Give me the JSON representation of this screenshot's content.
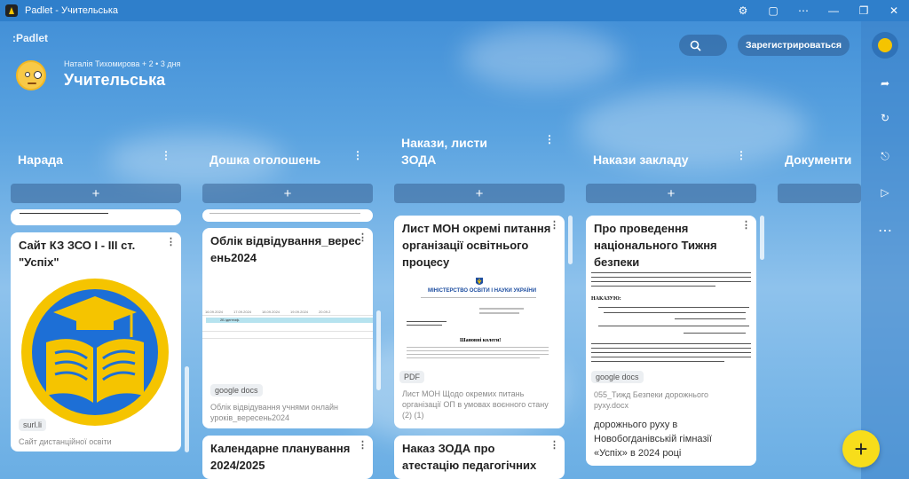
{
  "window": {
    "title": "Padlet - Учительська",
    "controls": [
      "Предпочтения",
      "Приложение",
      "Еще",
      "Свернуть",
      "Восстановить",
      "Закрыть"
    ]
  },
  "header": {
    "logo": ":Padlet",
    "meta": "Наталія Тихомирова + 2 • 3 дня",
    "title": "Учительська",
    "register_label": "Зарегистрироваться",
    "search_icon": "search-icon"
  },
  "rail": {
    "items": [
      "ideas-icon",
      "share-icon",
      "remake-icon",
      "bell-icon",
      "play-icon",
      "more-icon"
    ]
  },
  "fab_label": "+",
  "add_label": "+",
  "columns": [
    {
      "title": "Нарада",
      "cards": [
        {
          "title": "Сайт КЗ ЗСО І - ІІІ ст. \"Успіх\"",
          "tag": "surl.li",
          "subtitle": "Сайт дистанційної освіти",
          "colors": {
            "outer": "#f5c400",
            "inner": "#1d6fd6"
          }
        }
      ]
    },
    {
      "title": "Дошка оголошень",
      "cards": [
        {
          "title": "Облік відвідування_вересень2024",
          "tag": "google docs",
          "subtitle": "Облік відвідування учнями онлайн уроків_вересень2024",
          "sheet_dates": [
            "16.09.2024",
            "17.09.2024",
            "18.09.2024",
            "19.09.2024",
            "20.09.2"
          ],
          "sheet_label": "2Б ідентиф."
        },
        {
          "title": "Календарне планування 2024/2025"
        }
      ]
    },
    {
      "title": "Накази, листи ЗОДА",
      "cards": [
        {
          "title": "Лист МОН окремі питання організації освітнього процесу",
          "tag": "PDF",
          "subtitle": "Лист МОН Щодо окремих питань організації ОП в умовах воєнного стану (2) (1)",
          "doc_header": "МІНІСТЕРСТВО ОСВІТИ І НАУКИ УКРАЇНИ",
          "doc_greeting": "Шановні колеги!"
        },
        {
          "title": "Наказ ЗОДА про атестацію педагогічних"
        }
      ]
    },
    {
      "title": "Накази закладу",
      "cards": [
        {
          "title": "Про проведення національного Тижня безпеки",
          "tag": "google docs",
          "subtitle": "055_Тижд Безпеки дорожнього руху.docx",
          "doc_heading": "НАКАЗУЮ:",
          "extra": "дорожнього руху в Новобогданівській гімназії «Успіх» в 2024 році"
        }
      ]
    },
    {
      "title": "Документи"
    }
  ]
}
